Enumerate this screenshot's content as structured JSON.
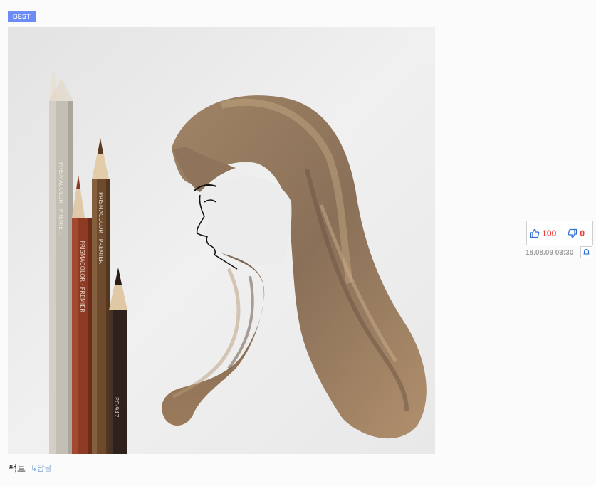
{
  "badge": {
    "label": "BEST"
  },
  "comment": {
    "text": "팩트",
    "reply_label": "↳답글"
  },
  "votes": {
    "up_count": "100",
    "down_count": "0",
    "up_icon": "thumbs-up-icon",
    "down_icon": "thumbs-down-icon"
  },
  "meta": {
    "date": "18.08.09 03:30",
    "notify_icon": "bell-icon"
  },
  "image": {
    "pencil_labels": [
      "PRISMACOLOR · PREMIER",
      "PRISMACOLOR · PREMIER",
      "PRISMACOLOR · PREMIER",
      "PC-947"
    ]
  },
  "colors": {
    "accent_badge": "#6c8cf5",
    "count_red": "#e53935",
    "reply_blue": "#7aa4cf",
    "icon_blue": "#2f6fd6"
  }
}
